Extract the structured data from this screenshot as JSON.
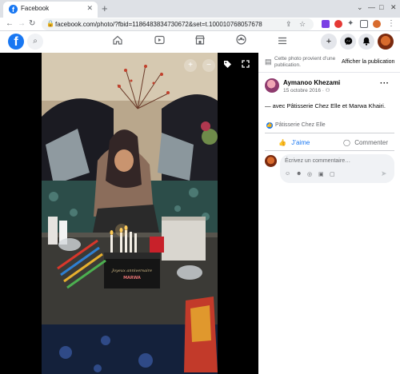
{
  "browser": {
    "tab_title": "Facebook",
    "url": "facebook.com/photo/?fbid=1186483834730672&set=t.100010768057678",
    "window_controls": [
      "⌄",
      "—",
      "□",
      "✕"
    ]
  },
  "fb_header": {
    "logo": "f",
    "nav_icons": [
      "home-icon",
      "watch-icon",
      "marketplace-icon",
      "groups-icon",
      "menu-icon"
    ],
    "right_icons": [
      "plus-icon",
      "messenger-icon",
      "notifications-icon"
    ]
  },
  "viewer": {
    "zoom_in": "+",
    "zoom_out": "−"
  },
  "panel": {
    "notice_text": "Cette photo provient d’une publication.",
    "notice_link": "Afficher la publication",
    "author": "Aymanoo Khezami",
    "date": "15 octobre 2016 · ",
    "post_prefix": "— avec ",
    "post_tag1": "Pâtisserie Chez Elle",
    "post_mid": " et ",
    "post_tag2": "Marwa Khairi",
    "post_suffix": ".",
    "reaction_name": "Pâtisserie Chez Elle",
    "like_label": "J’aime",
    "comment_label": "Commenter",
    "comment_placeholder": "Écrivez un commentaire…"
  },
  "colors": {
    "brand": "#1877f2",
    "muted": "#65676b"
  }
}
